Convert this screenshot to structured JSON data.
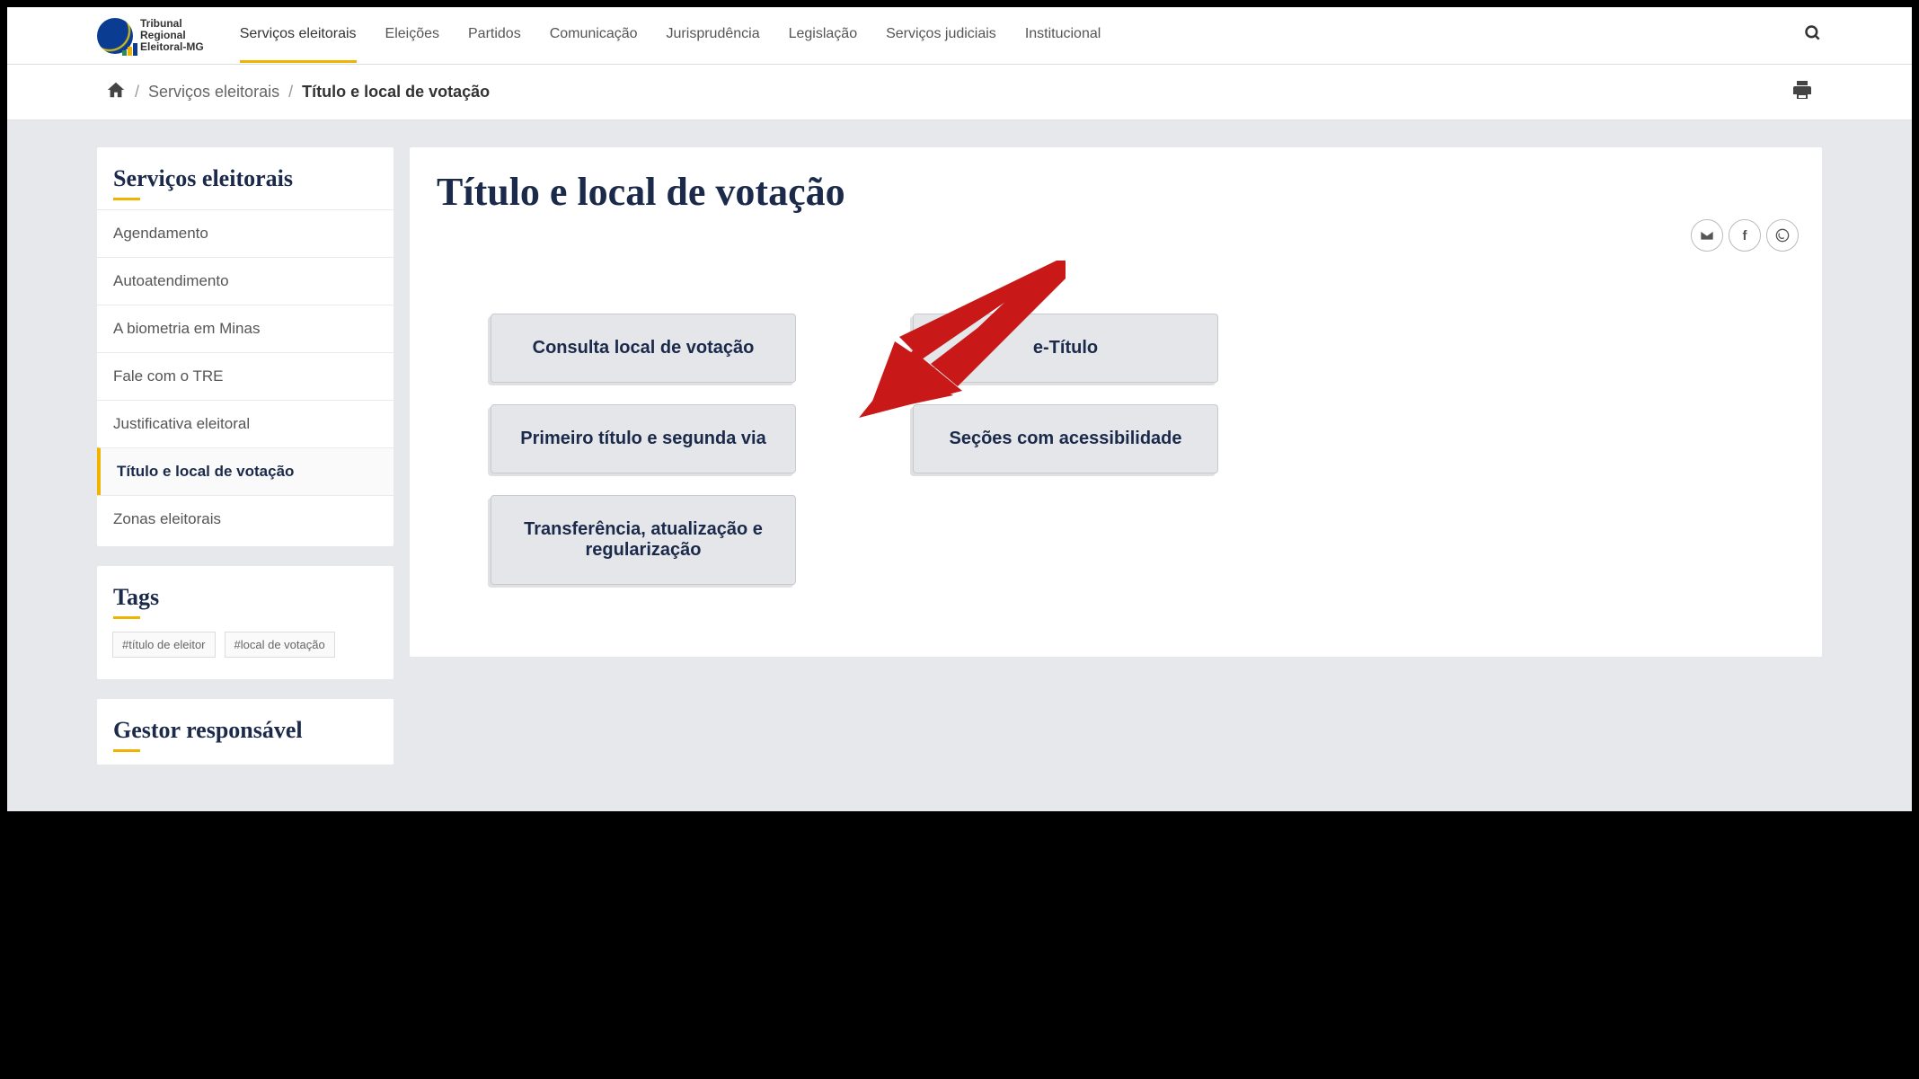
{
  "header": {
    "org_name_line1": "Tribunal",
    "org_name_line2": "Regional",
    "org_name_line3": "Eleitoral-MG",
    "nav": [
      {
        "label": "Serviços eleitorais",
        "active": true
      },
      {
        "label": "Eleições",
        "active": false
      },
      {
        "label": "Partidos",
        "active": false
      },
      {
        "label": "Comunicação",
        "active": false
      },
      {
        "label": "Jurisprudência",
        "active": false
      },
      {
        "label": "Legislação",
        "active": false
      },
      {
        "label": "Serviços judiciais",
        "active": false
      },
      {
        "label": "Institucional",
        "active": false
      }
    ]
  },
  "breadcrumb": {
    "items": [
      {
        "label": "Serviços eleitorais"
      },
      {
        "label": "Título e local de votação"
      }
    ]
  },
  "sidebar": {
    "title": "Serviços eleitorais",
    "items": [
      {
        "label": "Agendamento",
        "active": false
      },
      {
        "label": "Autoatendimento",
        "active": false
      },
      {
        "label": "A biometria em Minas",
        "active": false
      },
      {
        "label": "Fale com o TRE",
        "active": false
      },
      {
        "label": "Justificativa eleitoral",
        "active": false
      },
      {
        "label": "Título e local de votação",
        "active": true
      },
      {
        "label": "Zonas eleitorais",
        "active": false
      }
    ],
    "tags_title": "Tags",
    "tags": [
      {
        "label": "#título de eleitor"
      },
      {
        "label": "#local de votação"
      }
    ],
    "manager_title": "Gestor responsável"
  },
  "main": {
    "title": "Título e local de votação",
    "share": {
      "email": "email",
      "facebook": "f",
      "whatsapp": "whatsapp"
    },
    "cards": [
      {
        "label": "Consulta local de votação"
      },
      {
        "label": "e-Título"
      },
      {
        "label": "Primeiro título e segunda via"
      },
      {
        "label": "Seções com acessibilidade"
      },
      {
        "label": "Transferência, atualização e regularização"
      }
    ]
  }
}
